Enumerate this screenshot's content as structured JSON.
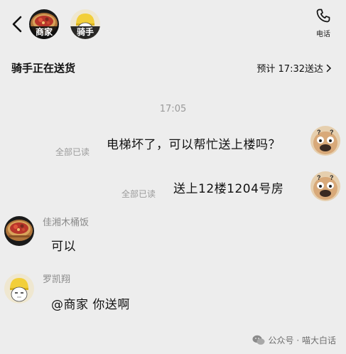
{
  "header": {
    "back_icon": "chevron-left-icon",
    "avatars": [
      {
        "label": "商家",
        "icon": "food-bowl-icon"
      },
      {
        "label": "骑手",
        "icon": "rider-avatar-icon"
      }
    ],
    "call_label": "电话",
    "call_icon": "phone-icon"
  },
  "order_status": {
    "text": "骑手正在送货",
    "eta": "预计 17:32送达"
  },
  "chat": {
    "timestamp": "17:05",
    "messages": [
      {
        "sender": "me",
        "text": "电梯坏了，可以帮忙送上楼吗？",
        "read_receipt": "全部已读"
      },
      {
        "sender": "me",
        "text": "送上12楼1204号房",
        "read_receipt": "全部已读"
      },
      {
        "sender": "merchant",
        "name": "佳湘木桶饭",
        "text": "可以"
      },
      {
        "sender": "rider",
        "name": "罗凯翔",
        "text": "@商家 你送啊"
      }
    ]
  },
  "watermark": {
    "text": "公众号 · 喵大白话",
    "icon": "wechat-icon"
  }
}
